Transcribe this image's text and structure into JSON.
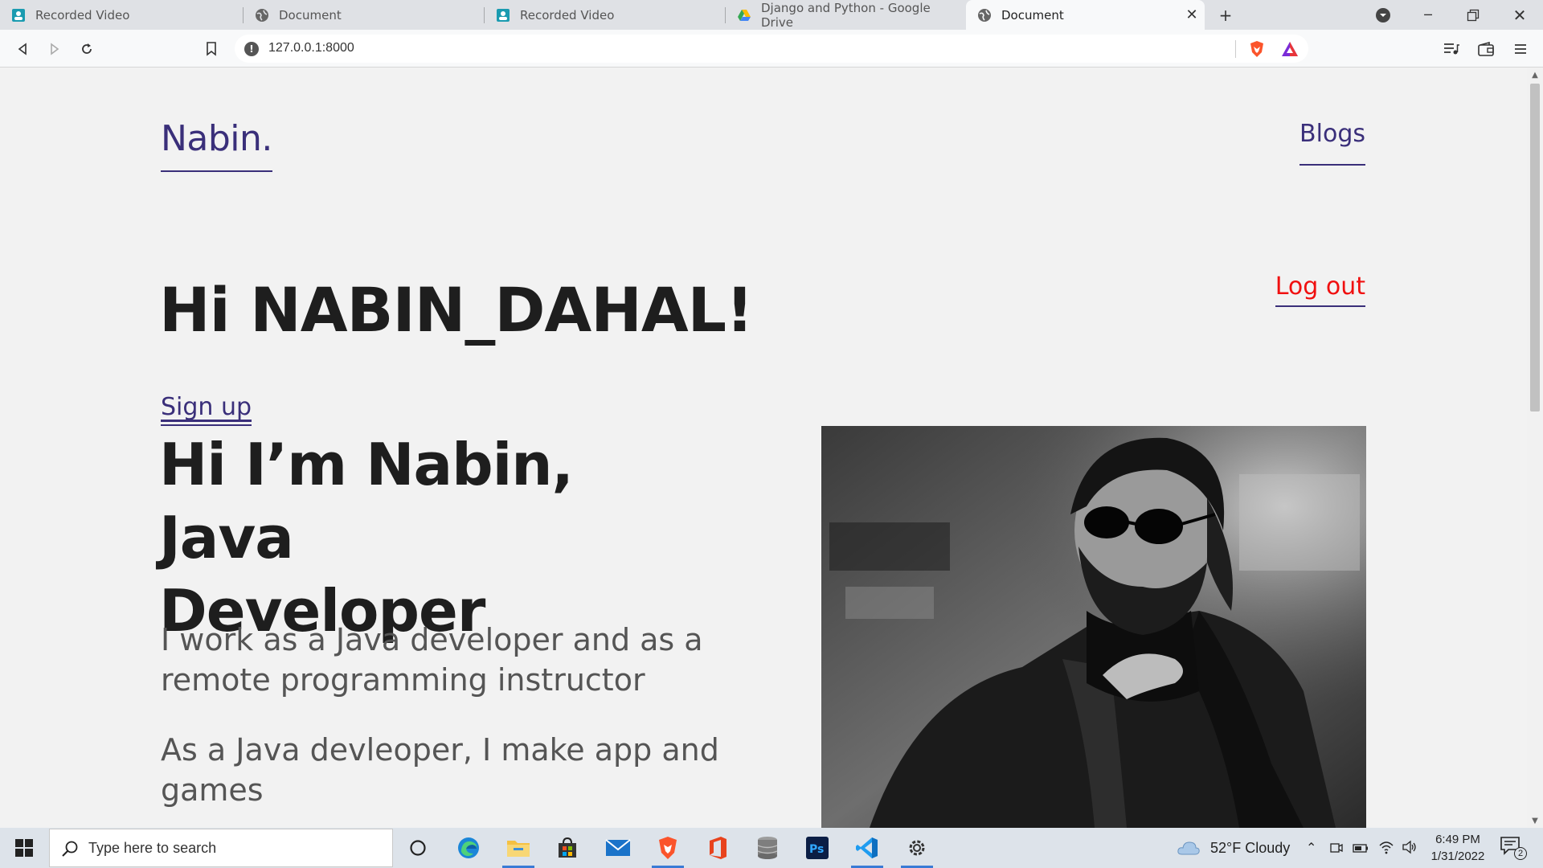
{
  "browser": {
    "tabs": [
      {
        "title": "Recorded Video",
        "icon": "recorded-video-icon",
        "active": false
      },
      {
        "title": "Document",
        "icon": "globe-icon",
        "active": false
      },
      {
        "title": "Recorded Video",
        "icon": "recorded-video-icon",
        "active": false
      },
      {
        "title": "Django and Python - Google Drive",
        "icon": "google-drive-icon",
        "active": false
      },
      {
        "title": "Document",
        "icon": "globe-icon",
        "active": true
      }
    ],
    "url": "127.0.0.1:8000",
    "accent_color": "#3a2f7a"
  },
  "site": {
    "logo": "Nabin.",
    "nav": {
      "blogs": "Blogs"
    },
    "greeting": "Hi NABIN_DAHAL!",
    "logout": "Log out",
    "signup": "Sign up",
    "hero_title_line1": "Hi I’m Nabin, Java",
    "hero_title_line2": "Developer",
    "hero_p1_line1": "I work as a Java developer and as a",
    "hero_p1_line2": "remote programming instructor",
    "hero_p2_line1": "As a Java devleoper, I make app and",
    "hero_p2_line2": "games",
    "logout_color": "#f01010"
  },
  "taskbar": {
    "search_placeholder": "Type here to search",
    "weather": "52°F  Cloudy",
    "time": "6:49 PM",
    "date": "1/31/2022",
    "notification_count": "2",
    "apps": [
      "cortana-icon",
      "edge-icon",
      "file-explorer-icon",
      "store-icon",
      "mail-icon",
      "brave-icon",
      "office-icon",
      "database-icon",
      "photoshop-icon",
      "vscode-icon",
      "settings-icon"
    ]
  }
}
